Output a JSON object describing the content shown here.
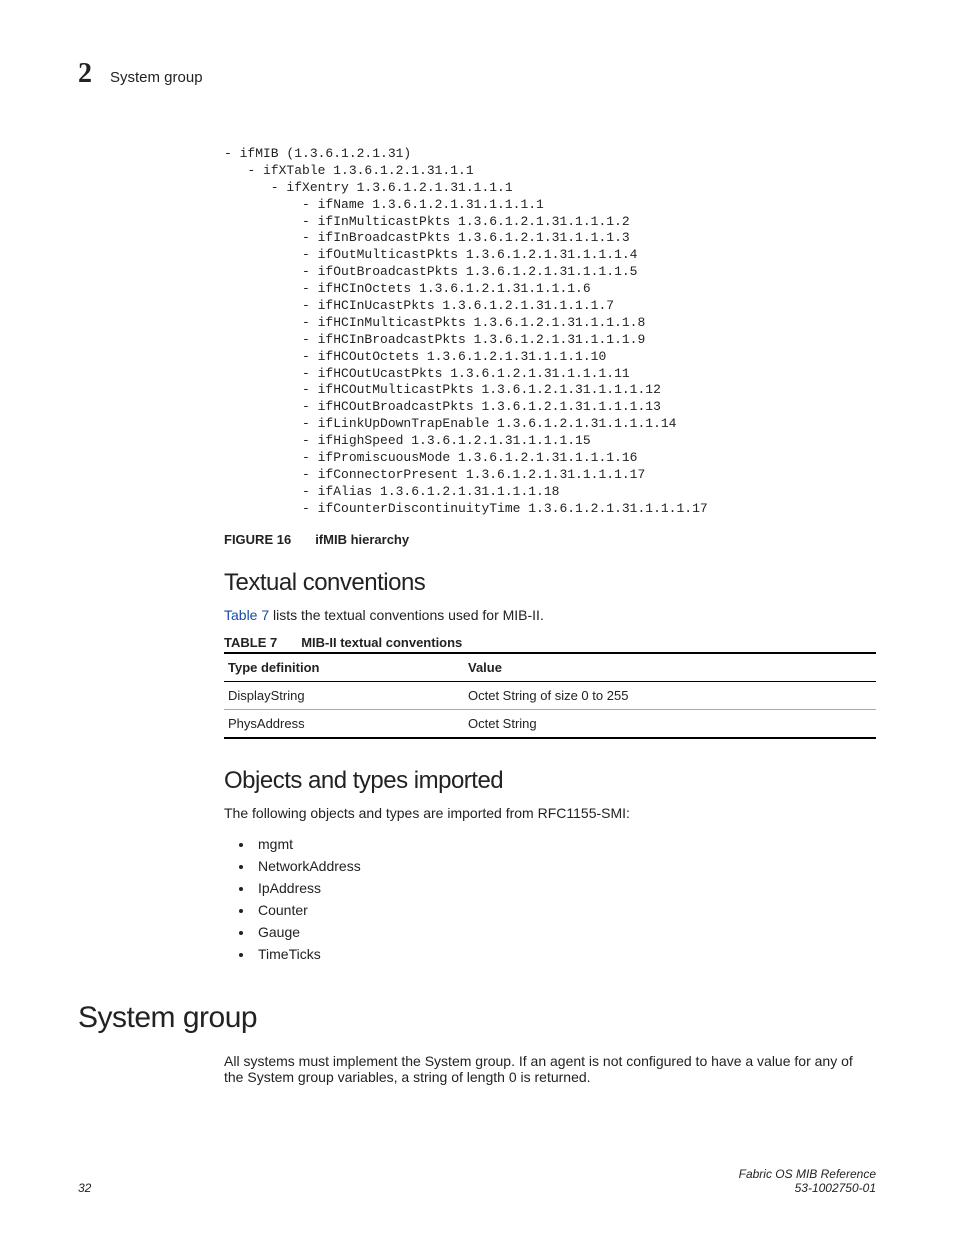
{
  "header": {
    "chapter_number": "2",
    "running_title": "System group"
  },
  "mib_tree": [
    "- ifMIB (1.3.6.1.2.1.31)",
    "   - ifXTable 1.3.6.1.2.1.31.1.1",
    "      - ifXentry 1.3.6.1.2.1.31.1.1.1",
    "          - ifName 1.3.6.1.2.1.31.1.1.1.1",
    "          - ifInMulticastPkts 1.3.6.1.2.1.31.1.1.1.2",
    "          - ifInBroadcastPkts 1.3.6.1.2.1.31.1.1.1.3",
    "          - ifOutMulticastPkts 1.3.6.1.2.1.31.1.1.1.4",
    "          - ifOutBroadcastPkts 1.3.6.1.2.1.31.1.1.1.5",
    "          - ifHCInOctets 1.3.6.1.2.1.31.1.1.1.6",
    "          - ifHCInUcastPkts 1.3.6.1.2.1.31.1.1.1.7",
    "          - ifHCInMulticastPkts 1.3.6.1.2.1.31.1.1.1.8",
    "          - ifHCInBroadcastPkts 1.3.6.1.2.1.31.1.1.1.9",
    "          - ifHCOutOctets 1.3.6.1.2.1.31.1.1.1.10",
    "          - ifHCOutUcastPkts 1.3.6.1.2.1.31.1.1.1.11",
    "          - ifHCOutMulticastPkts 1.3.6.1.2.1.31.1.1.1.12",
    "          - ifHCOutBroadcastPkts 1.3.6.1.2.1.31.1.1.1.13",
    "          - ifLinkUpDownTrapEnable 1.3.6.1.2.1.31.1.1.1.14",
    "          - ifHighSpeed 1.3.6.1.2.1.31.1.1.1.15",
    "          - ifPromiscuousMode 1.3.6.1.2.1.31.1.1.1.16",
    "          - ifConnectorPresent 1.3.6.1.2.1.31.1.1.1.17",
    "          - ifAlias 1.3.6.1.2.1.31.1.1.1.18",
    "          - ifCounterDiscontinuityTime 1.3.6.1.2.1.31.1.1.1.17"
  ],
  "figure": {
    "label": "FIGURE 16",
    "title": "ifMIB hierarchy"
  },
  "section_textual": {
    "heading": "Textual conventions",
    "intro_pre": "Table 7",
    "intro_post": " lists the textual conventions used for MIB-II."
  },
  "table": {
    "label": "TABLE 7",
    "title": "MIB-II textual conventions",
    "headers": {
      "c1": "Type definition",
      "c2": "Value"
    },
    "rows": [
      {
        "c1": "DisplayString",
        "c2": "Octet String of size 0 to 255"
      },
      {
        "c1": "PhysAddress",
        "c2": "Octet String"
      }
    ]
  },
  "section_objects": {
    "heading": "Objects and types imported",
    "intro": "The following objects and types are imported from RFC1155-SMI:",
    "items": [
      "mgmt",
      "NetworkAddress",
      "IpAddress",
      "Counter",
      "Gauge",
      "TimeTicks"
    ]
  },
  "section_system": {
    "heading": "System group",
    "body": "All systems must implement the System group. If an agent is not configured to have a value for any of the System group variables, a string of length 0 is returned."
  },
  "footer": {
    "page": "32",
    "doc_title": "Fabric OS MIB Reference",
    "doc_number": "53-1002750-01"
  }
}
